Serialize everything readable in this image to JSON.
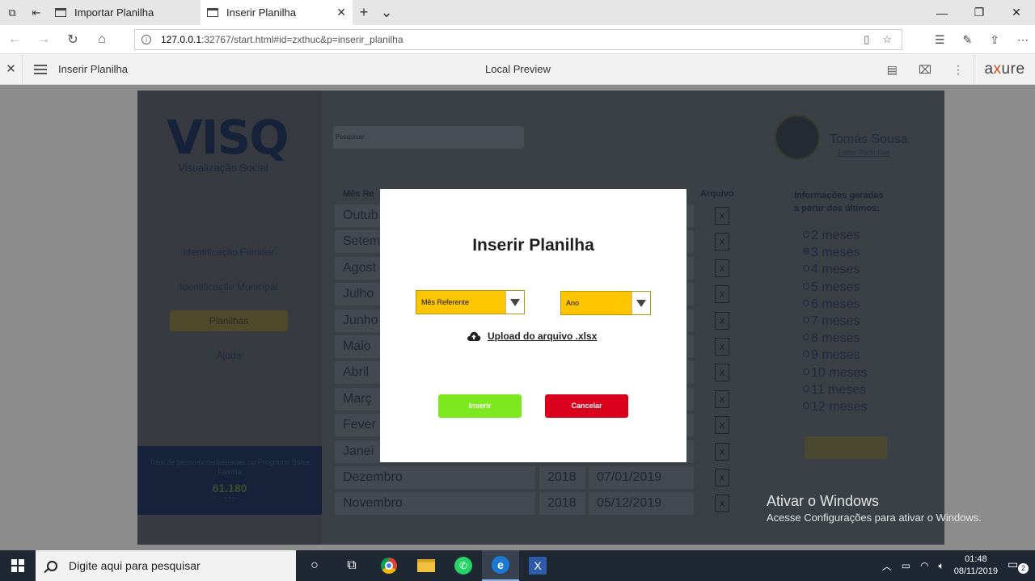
{
  "browser": {
    "tabs": [
      {
        "label": "Importar Planilha"
      },
      {
        "label": "Inserir Planilha"
      }
    ],
    "url_host": "127.0.0.1",
    "url_rest": ":32767/start.html#id=zxthuc&p=inserir_planilha"
  },
  "axure": {
    "page_name": "Inserir Planilha",
    "center_label": "Local Preview",
    "logo": "axure"
  },
  "app": {
    "logo": "VISQ",
    "logo_subtitle": "Visualização Social",
    "search_placeholder": "Pesquisar",
    "user_name": "Tomás Sousa",
    "user_links": "Editar Perfil   Sair",
    "sidebar": [
      {
        "label": "Identificação Familiar"
      },
      {
        "label": "Identificação Municipal"
      },
      {
        "label": "Planilhas"
      },
      {
        "label": "Ajuda"
      }
    ],
    "stat_label": "Total de pessoas cadastradas no Programa Bolsa Família",
    "stat_value": "61.180",
    "stat_dots": "• • •",
    "table": {
      "col_month": "Mês Re",
      "col_file": "Arquivo",
      "rows": [
        {
          "month": "Outub",
          "year": "",
          "date": ""
        },
        {
          "month": "Setem",
          "year": "",
          "date": ""
        },
        {
          "month": "Agost",
          "year": "",
          "date": ""
        },
        {
          "month": "Julho",
          "year": "",
          "date": ""
        },
        {
          "month": "Junho",
          "year": "",
          "date": ""
        },
        {
          "month": "Maio",
          "year": "",
          "date": ""
        },
        {
          "month": "Abril",
          "year": "",
          "date": ""
        },
        {
          "month": "Març",
          "year": "",
          "date": ""
        },
        {
          "month": "Fever",
          "year": "",
          "date": ""
        },
        {
          "month": "Janei",
          "year": "",
          "date": ""
        },
        {
          "month": "Dezembro",
          "year": "2018",
          "date": "07/01/2019"
        },
        {
          "month": "Novembro",
          "year": "2018",
          "date": "05/12/2019"
        }
      ]
    },
    "info_title_1": "Informações geradas",
    "info_title_2": "a partir dos últimos:",
    "period_options": [
      {
        "label": "2 meses",
        "selected": false
      },
      {
        "label": "3 meses",
        "selected": true
      },
      {
        "label": "4 meses",
        "selected": false
      },
      {
        "label": "5 meses",
        "selected": false
      },
      {
        "label": "6 meses",
        "selected": false
      },
      {
        "label": "7 meses",
        "selected": false
      },
      {
        "label": "8 meses",
        "selected": false
      },
      {
        "label": "9 meses",
        "selected": false
      },
      {
        "label": "10 meses",
        "selected": false
      },
      {
        "label": "11 meses",
        "selected": false
      },
      {
        "label": "12 meses",
        "selected": false
      }
    ]
  },
  "modal": {
    "title": "Inserir Planilha",
    "month_select": "Mês Referente",
    "year_select": "Ano",
    "upload_label": "Upload do arquivo .xlsx",
    "insert_label": "Inserir",
    "cancel_label": "Cancelar",
    "colors": {
      "select": "#fdc601",
      "insert": "#7ee81e",
      "cancel": "#d9001b"
    }
  },
  "watermark": {
    "line1": "Ativar o Windows",
    "line2": "Acesse Configurações para ativar o Windows."
  },
  "taskbar": {
    "search_placeholder": "Digite aqui para pesquisar",
    "time": "01:48",
    "date": "08/11/2019",
    "notifications": "2"
  }
}
